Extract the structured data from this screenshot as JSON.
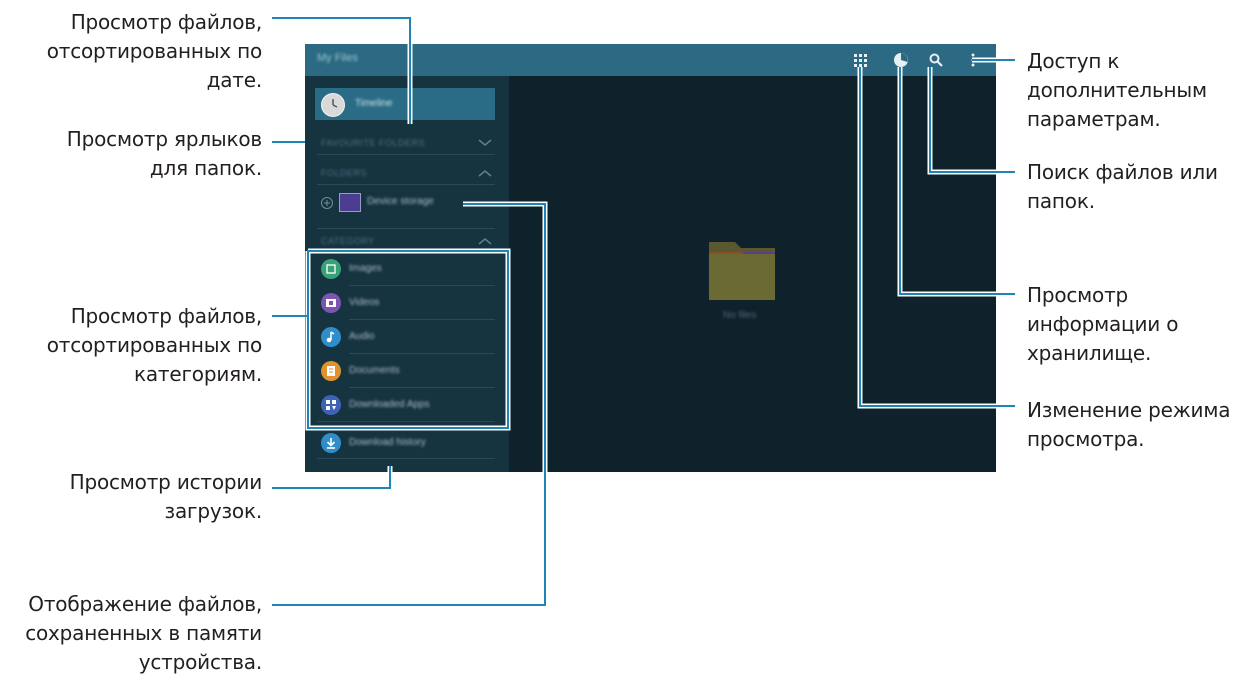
{
  "app": {
    "title": "My Files",
    "empty_state": "No files"
  },
  "drawer": {
    "timeline_label": "Timeline",
    "favourite_folders_header": "FAVOURITE FOLDERS",
    "folders_header": "FOLDERS",
    "device_storage_label": "Device storage",
    "categories_header": "CATEGORY",
    "categories": [
      {
        "label": "Images",
        "color": "#39a178"
      },
      {
        "label": "Videos",
        "color": "#7b55b0"
      },
      {
        "label": "Audio",
        "color": "#2f8ec9"
      },
      {
        "label": "Documents",
        "color": "#e0922e"
      },
      {
        "label": "Downloaded Apps",
        "color": "#3e62b5"
      }
    ],
    "download_history_label": "Download history",
    "download_history_color": "#2f8ec9"
  },
  "actionbar_icons": [
    "grid-view-icon",
    "storage-pie-icon",
    "search-icon",
    "more-options-icon"
  ],
  "callouts": {
    "by_date": [
      "Просмотр файлов,",
      "отсортированных по",
      "дате."
    ],
    "shortcuts": [
      "Просмотр ярлыков",
      "для папок."
    ],
    "by_category": [
      "Просмотр файлов,",
      "отсортированных по",
      "категориям."
    ],
    "download_history": [
      "Просмотр истории",
      "загрузок."
    ],
    "device_storage": [
      "Отображение файлов,",
      "сохраненных в памяти",
      "устройства."
    ],
    "more_options": [
      "Доступ к",
      "дополнительным",
      "параметрам."
    ],
    "search": [
      "Поиск файлов или",
      "папок."
    ],
    "storage_info": [
      "Просмотр",
      "информации о",
      "хранилище."
    ],
    "view_mode": [
      "Изменение режима",
      "просмотра."
    ]
  },
  "colors": {
    "leader": "#1f86b4",
    "actionbar": "#2b6a82",
    "drawer": "#163340",
    "main": "#0f212a",
    "folder": "#6b6a35"
  }
}
